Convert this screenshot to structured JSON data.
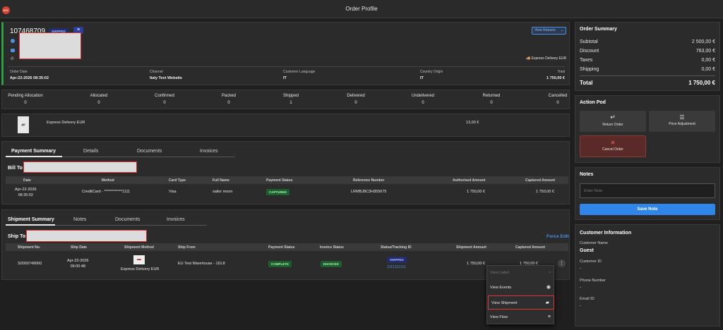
{
  "header": {
    "title": "Order Profile",
    "logo_text": "K/Y"
  },
  "order": {
    "number": "107468709",
    "status": "SHIPPED",
    "view_returns": "View Returns",
    "delivery_method": "Express Delivery EUR",
    "info": [
      {
        "label": "Order Date",
        "value": "Apr-22-2026 08:35:02"
      },
      {
        "label": "Channel",
        "value": "Italy Test Website"
      },
      {
        "label": "Customer Language",
        "value": "IT"
      },
      {
        "label": "Country Origin",
        "value": "IT"
      },
      {
        "label": "Total",
        "value": "1 750,00 €"
      }
    ]
  },
  "statuses": [
    {
      "label": "Pending Allocation",
      "value": "0"
    },
    {
      "label": "Allocated",
      "value": "0"
    },
    {
      "label": "Confirmed",
      "value": "0"
    },
    {
      "label": "Packed",
      "value": "0"
    },
    {
      "label": "Shipped",
      "value": "1"
    },
    {
      "label": "Delivered",
      "value": "0"
    },
    {
      "label": "Undelivered",
      "value": "0"
    },
    {
      "label": "Returned",
      "value": "0"
    },
    {
      "label": "Cancelled",
      "value": "0"
    }
  ],
  "shipping_line": {
    "name": "Express Delivery EUR",
    "amount": "13,00 €"
  },
  "payment": {
    "tabs": [
      "Payment Summary",
      "Details",
      "Documents",
      "Invoices"
    ],
    "bill_to": "Bill To :",
    "headers": [
      "Date",
      "Method",
      "Card Type",
      "Full Name",
      "Payment Status",
      "Reference Number",
      "Authorised Amount",
      "Captured Amount"
    ],
    "row": {
      "date": "Apr-22-2026",
      "time": "08:35:02",
      "method": "CreditCard - ************1111",
      "card_type": "Visa",
      "full_name": "sailor moon",
      "status": "CAPTURED",
      "reference": "LRMBJ8C3H355675",
      "authorised": "1 750,00 €",
      "captured": "1 750,00 €"
    }
  },
  "shipment": {
    "tabs": [
      "Shipment Summary",
      "Notes",
      "Documents",
      "Invoices"
    ],
    "ship_to": "Ship To :",
    "force_edit": "Force Edit",
    "headers": [
      "Shipment No.",
      "Ship Date",
      "Shipment Method",
      "Ship From",
      "Payment Status",
      "Invoice Status",
      "Status/Tracking ID",
      "Shipment Amount",
      "Captured Amount"
    ],
    "row": {
      "number": "S0000749060",
      "date": "Apr-22-2026",
      "time": "09:00:48",
      "method": "Express Delivery EUR",
      "from": "EU Test Warehouse - 1DL8",
      "payment_status": "COMPLETE",
      "invoice_status": "INVOICED",
      "tracking_status": "SHIPPED",
      "tracking_id": "1111111111",
      "amount": "1 750,00 €",
      "captured": "1 750,00 €"
    },
    "menu": [
      "View Label",
      "View Events",
      "View Shipment",
      "View Flow"
    ]
  },
  "summary": {
    "title": "Order Summary",
    "rows": [
      {
        "label": "Subtotal",
        "value": "2 500,00 €"
      },
      {
        "label": "Discount",
        "value": "763,00 €"
      },
      {
        "label": "Taxes",
        "value": "0,00 €"
      },
      {
        "label": "Shipping",
        "value": "0,00 €"
      }
    ],
    "total_label": "Total",
    "total_value": "1 750,00 €"
  },
  "action_pod": {
    "title": "Action Pod",
    "return": "Return Order",
    "price": "Price Adjustment",
    "cancel": "Cancel Order"
  },
  "notes": {
    "title": "Notes",
    "placeholder": "Enter Note",
    "save": "Save Note"
  },
  "customer": {
    "title": "Customer Information",
    "fields": [
      {
        "label": "Customer Name",
        "value": "Guest"
      },
      {
        "label": "Customer ID",
        "value": "-"
      },
      {
        "label": "Phone Number",
        "value": "-"
      },
      {
        "label": "Email ID",
        "value": "-"
      }
    ]
  },
  "colors": {
    "accent": "#2f86e8",
    "success": "#2ea043",
    "danger": "#c0392b"
  }
}
